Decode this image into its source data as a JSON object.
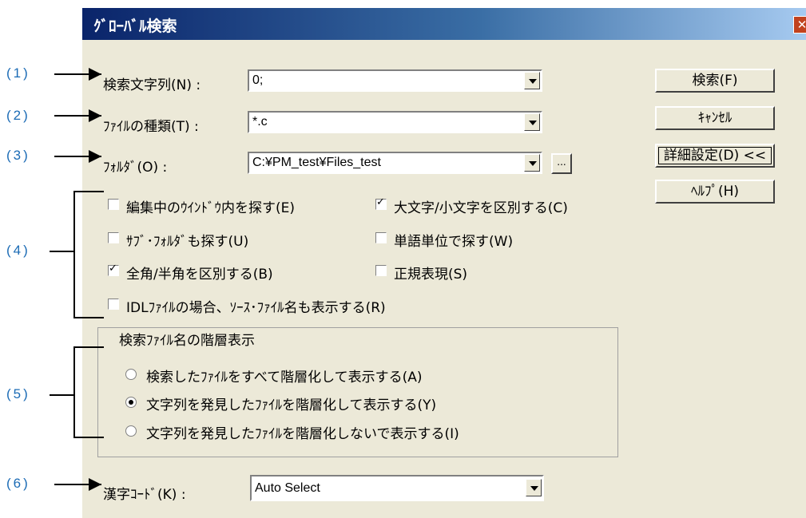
{
  "window": {
    "title": "ｸﾞﾛｰﾊﾞﾙ検索",
    "close_glyph": "✕"
  },
  "callouts": [
    "(1)",
    "(2)",
    "(3)",
    "(4)",
    "(5)",
    "(6)"
  ],
  "fields": {
    "search_string": {
      "label": "検索文字列(N) :",
      "value": "0;"
    },
    "file_type": {
      "label": "ﾌｧｲﾙの種類(T) :",
      "value": "*.c"
    },
    "folder": {
      "label": "ﾌｫﾙﾀﾞ(O) :",
      "value": "C:¥PM_test¥Files_test",
      "browse_label": "..."
    },
    "kanji_code": {
      "label": "漢字ｺｰﾄﾞ(K) :",
      "value": "Auto Select"
    }
  },
  "buttons": {
    "search": "検索(F)",
    "cancel": "ｷｬﾝｾﾙ",
    "details": "詳細設定(D) <<",
    "help": "ﾍﾙﾌﾟ(H)"
  },
  "options": [
    {
      "label": "編集中のｳｲﾝﾄﾞｳ内を探す(E)",
      "checked": false
    },
    {
      "label": "大文字/小文字を区別する(C)",
      "checked": true
    },
    {
      "label": "ｻﾌﾞ･ﾌｫﾙﾀﾞも探す(U)",
      "checked": false
    },
    {
      "label": "単語単位で探す(W)",
      "checked": false
    },
    {
      "label": "全角/半角を区別する(B)",
      "checked": true
    },
    {
      "label": "正規表現(S)",
      "checked": false
    },
    {
      "label": "IDLﾌｧｲﾙの場合、ｿｰｽ･ﾌｧｲﾙ名も表示する(R)",
      "checked": false
    }
  ],
  "hierarchy": {
    "title": "検索ﾌｧｲﾙ名の階層表示",
    "choices": [
      {
        "label": "検索したﾌｧｲﾙをすべて階層化して表示する(A)",
        "selected": false
      },
      {
        "label": "文字列を発見したﾌｧｲﾙを階層化して表示する(Y)",
        "selected": true
      },
      {
        "label": "文字列を発見したﾌｧｲﾙを階層化しないで表示する(I)",
        "selected": false
      }
    ]
  },
  "colors": {
    "callout": "#1b6bb5",
    "titlebar": "#0a246a",
    "dialog": "#ece9d8"
  }
}
